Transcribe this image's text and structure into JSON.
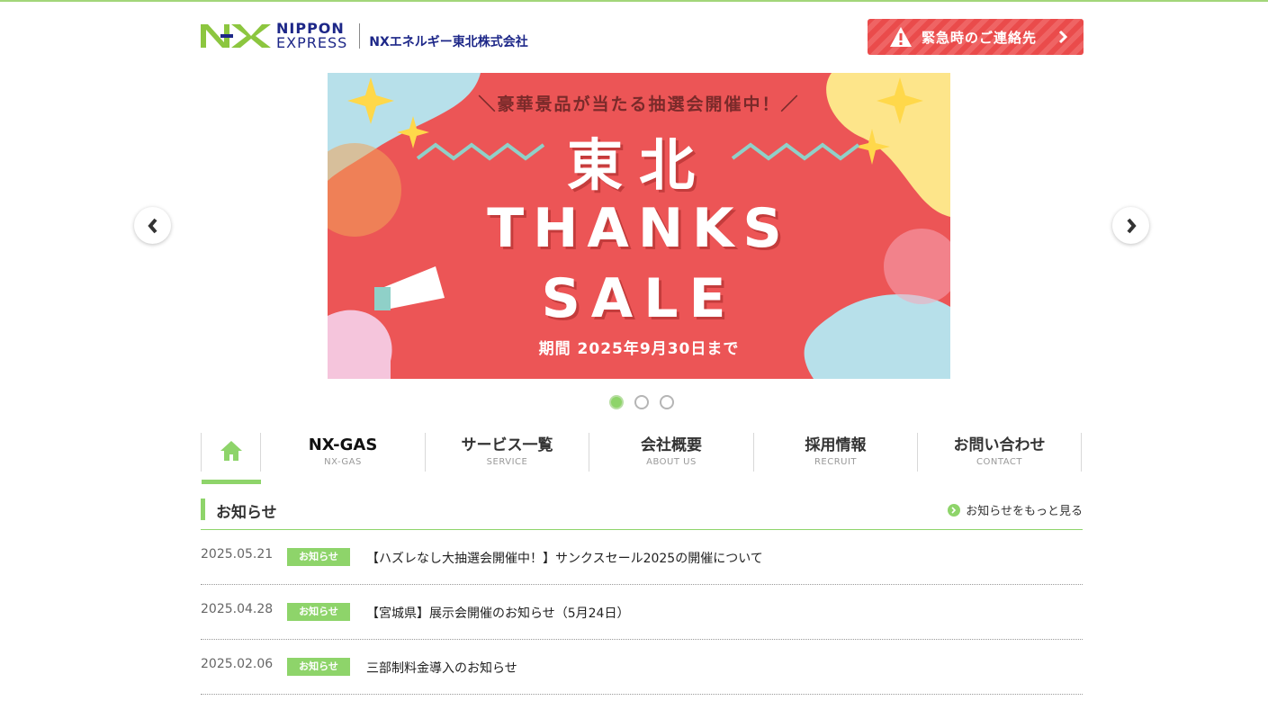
{
  "header": {
    "logo_line1": "NIPPON",
    "logo_line2": "EXPRESS",
    "company_name": "NXエネルギー東北株式会社",
    "emergency_label": "緊急時のご連絡先"
  },
  "slider": {
    "slide": {
      "tagline": "＼豪華景品が当たる抽選会開催中！／",
      "line1": "東北",
      "line2": "THANKS",
      "line3": "SALE",
      "period": "期間 2025年9月30日まで"
    },
    "dots_count": 3,
    "active_dot": 1
  },
  "gnav": {
    "items": [
      {
        "jp": "NX-GAS",
        "en": "NX-GAS"
      },
      {
        "jp": "サービス一覧",
        "en": "SERVICE"
      },
      {
        "jp": "会社概要",
        "en": "ABOUT US"
      },
      {
        "jp": "採用情報",
        "en": "RECRUIT"
      },
      {
        "jp": "お問い合わせ",
        "en": "CONTACT"
      }
    ]
  },
  "news": {
    "title": "お知らせ",
    "more_label": "お知らせをもっと見る",
    "items": [
      {
        "date": "2025.05.21",
        "badge": "お知らせ",
        "text": "【ハズレなし大抽選会開催中！】サンクスセール2025の開催について"
      },
      {
        "date": "2025.04.28",
        "badge": "お知らせ",
        "text": "【宮城県】展示会開催のお知らせ（5月24日）"
      },
      {
        "date": "2025.02.06",
        "badge": "お知らせ",
        "text": "三部制料金導入のお知らせ"
      }
    ]
  },
  "colors": {
    "accent_green": "#8ed46a",
    "brand_navy": "#1d2788",
    "logo_green": "#8cc63f",
    "emergency_red": "#ea4b4b",
    "slide_red": "#ec5556"
  }
}
